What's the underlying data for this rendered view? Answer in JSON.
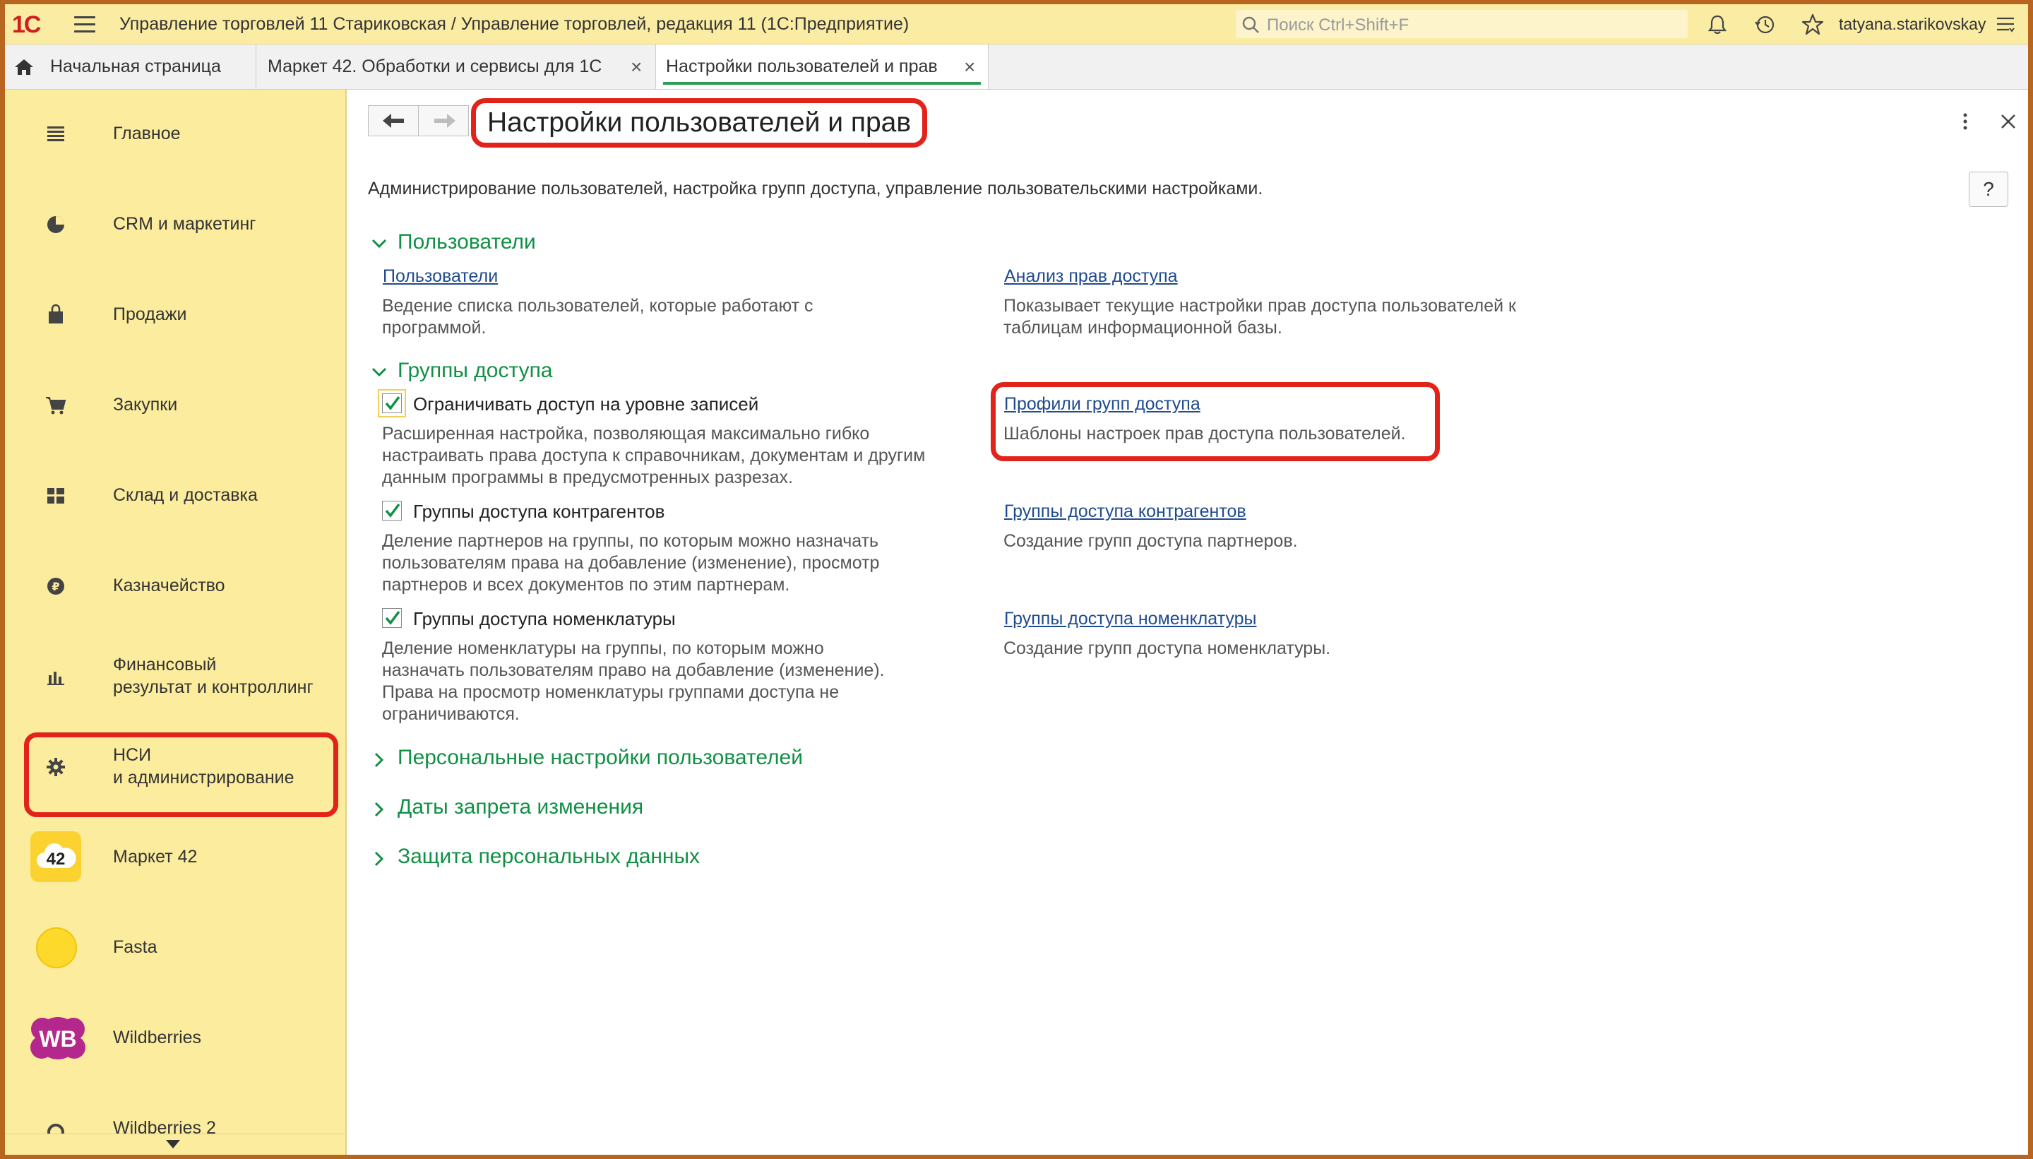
{
  "app": {
    "logo": "1С",
    "title": "Управление торговлей 11 Стариковская / Управление торговлей, редакция 11  (1С:Предприятие)",
    "search_placeholder": "Поиск Ctrl+Shift+F",
    "user": "tatyana.starikovskay"
  },
  "tabs": [
    {
      "label": "Начальная страница"
    },
    {
      "label": "Маркет 42. Обработки и сервисы для 1С",
      "close": "×"
    },
    {
      "label": "Настройки пользователей и прав",
      "close": "×"
    }
  ],
  "sidebar": {
    "items": [
      {
        "line1": "Главное",
        "line2": ""
      },
      {
        "line1": "CRM и маркетинг",
        "line2": ""
      },
      {
        "line1": "Продажи",
        "line2": ""
      },
      {
        "line1": "Закупки",
        "line2": ""
      },
      {
        "line1": "Склад и доставка",
        "line2": ""
      },
      {
        "line1": "Казначейство",
        "line2": ""
      },
      {
        "line1": "Финансовый",
        "line2": "результат и контроллинг"
      },
      {
        "line1": "НСИ",
        "line2": "и администрирование"
      },
      {
        "line1": "Маркет 42",
        "line2": "",
        "badge": "42"
      },
      {
        "line1": "Fasta",
        "line2": ""
      },
      {
        "line1": "Wildberries",
        "line2": "",
        "badge": "WB"
      },
      {
        "line1": "Wildberries 2",
        "line2": ""
      }
    ]
  },
  "page": {
    "title": "Настройки пользователей и прав",
    "description": "Администрирование пользователей, настройка групп доступа, управление пользовательскими настройками.",
    "help": "?"
  },
  "sections": {
    "users": {
      "title": "Пользователи",
      "left_link": "Пользователи",
      "left_note": [
        "Ведение списка пользователей, которые работают с",
        "программой."
      ],
      "right_link": "Анализ прав доступа",
      "right_note": [
        "Показывает текущие настройки прав доступа пользователей к",
        "таблицам информационной базы."
      ]
    },
    "groups": {
      "title": "Группы доступа",
      "cb1_label": "Ограничивать доступ на уровне записей",
      "cb1_note": [
        "Расширенная настройка, позволяющая максимально гибко",
        "настраивать права доступа к справочникам, документам и другим",
        "данным программы в предусмотренных разрезах."
      ],
      "cb1_link": "Профили групп доступа",
      "cb1_link_note": "Шаблоны настроек прав доступа пользователей.",
      "cb2_label": "Группы доступа контрагентов",
      "cb2_note": [
        "Деление партнеров на группы, по которым можно назначать",
        "пользователям права на добавление (изменение), просмотр",
        "партнеров и всех документов по этим партнерам."
      ],
      "cb2_link": "Группы доступа контрагентов",
      "cb2_link_note": "Создание групп доступа партнеров.",
      "cb3_label": "Группы доступа номенклатуры",
      "cb3_note": [
        "Деление номенклатуры на группы, по которым можно",
        "назначать пользователям право на добавление (изменение).",
        "Права на просмотр номенклатуры группами доступа не",
        "ограничиваются."
      ],
      "cb3_link": "Группы доступа номенклатуры",
      "cb3_link_note": "Создание групп доступа номенклатуры."
    },
    "collapsed": [
      "Персональные настройки пользователей",
      "Даты запрета изменения",
      "Защита персональных данных"
    ]
  },
  "colors": {
    "accent_green": "#119045",
    "link_blue": "#1f4b8f",
    "highlight_red": "#e2231a",
    "sidebar_bg": "#fcec9e"
  }
}
